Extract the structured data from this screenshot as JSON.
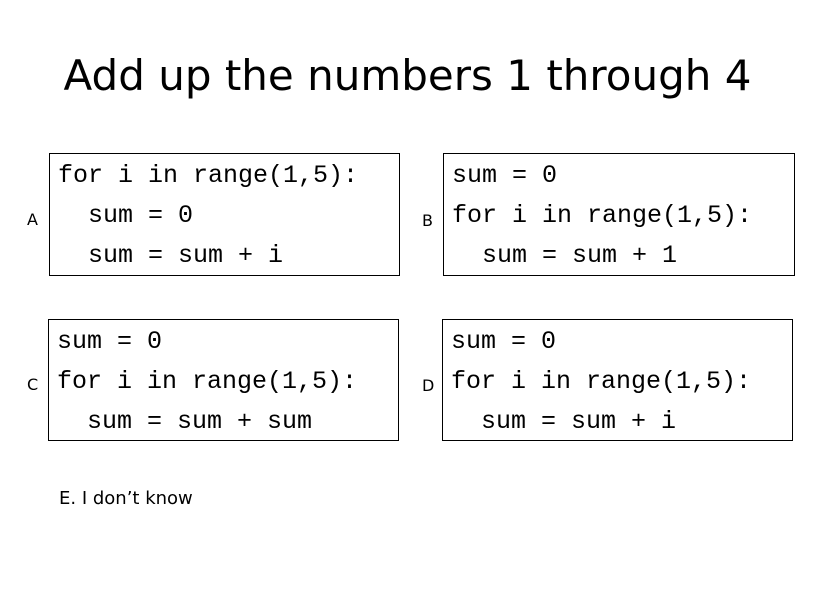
{
  "title": "Add up the numbers 1 through 4",
  "choices": [
    {
      "letter": "A",
      "lines": [
        "for i in range(1,5):",
        "sum = 0",
        "sum = sum + i"
      ]
    },
    {
      "letter": "B",
      "lines": [
        "sum = 0",
        "for i in range(1,5):",
        "sum = sum + 1"
      ]
    },
    {
      "letter": "C",
      "lines": [
        "sum = 0",
        "for i in range(1,5):",
        "sum = sum + sum"
      ]
    },
    {
      "letter": "D",
      "lines": [
        "sum = 0",
        "for i in range(1,5):",
        "sum = sum + i"
      ]
    }
  ],
  "option_e": "E. I don’t know"
}
